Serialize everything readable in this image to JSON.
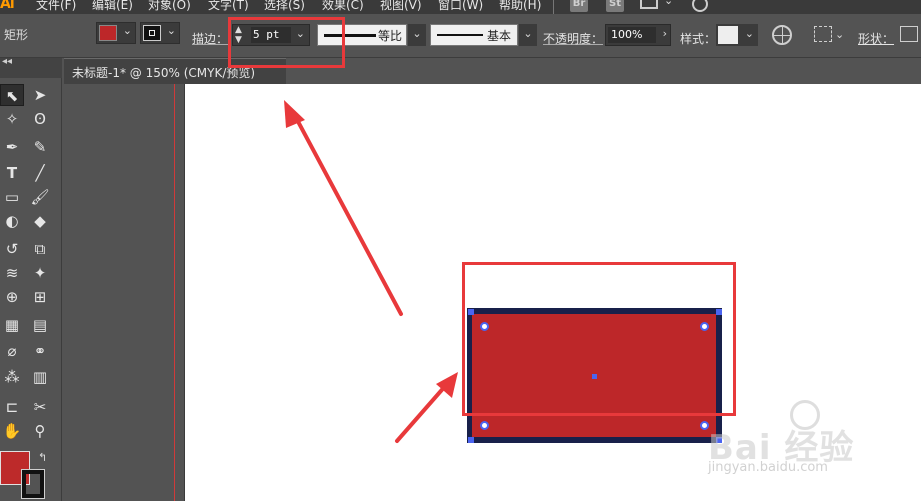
{
  "app": {
    "logo": "Ai"
  },
  "menu": {
    "items": [
      "文件(F)",
      "编辑(E)",
      "对象(O)",
      "文字(T)",
      "选择(S)",
      "效果(C)",
      "视图(V)",
      "窗口(W)",
      "帮助(H)"
    ],
    "badges": [
      "Br",
      "St"
    ]
  },
  "control": {
    "tool_name": "矩形",
    "fill_color": "#bd2729",
    "stroke_label": "描边：",
    "stroke_value": "5 pt",
    "profile_uniform": "等比",
    "brush_basic": "基本",
    "opacity_label": "不透明度：",
    "opacity_value": "100%",
    "style_label": "样式：",
    "shape_label": "形状："
  },
  "document": {
    "tab_title": "未标题-1* @ 150% (CMYK/预览)"
  },
  "object": {
    "fill": "#bd2729",
    "stroke": "#18204a"
  },
  "annotation": {
    "color": "#e8393b"
  },
  "watermark": {
    "brand": "Bai 经验",
    "url": "jingyan.baidu.com"
  }
}
